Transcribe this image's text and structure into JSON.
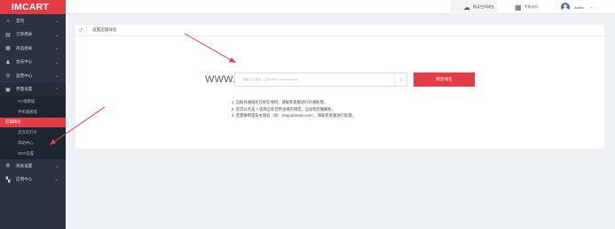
{
  "app": {
    "logo": "IMCART"
  },
  "sidebar": {
    "items": [
      {
        "label": "首页",
        "icon": "home-icon"
      },
      {
        "label": "订单相关",
        "icon": "order-icon"
      },
      {
        "label": "商品相关",
        "icon": "goods-icon"
      },
      {
        "label": "会员中心",
        "icon": "member-icon"
      },
      {
        "label": "运营中心",
        "icon": "operation-icon"
      },
      {
        "label": "界面设置",
        "icon": "layout-icon"
      },
      {
        "label": "系统设置",
        "icon": "settings-icon"
      },
      {
        "label": "应用中心",
        "icon": "apps-icon"
      }
    ],
    "sub_items": [
      "PC端模版",
      "手机端模版",
      "店铺域名",
      "首页幻灯片",
      "帮助中心",
      "SEO设置"
    ]
  },
  "header": {
    "tools": [
      {
        "label": "购买空间域名",
        "icon": "cloud-link-icon"
      },
      {
        "label": "手机访问",
        "icon": "qrcode-icon"
      }
    ],
    "user": {
      "name": "Admin",
      "icon": "avatar-icon"
    }
  },
  "main": {
    "title": "设置店铺域名",
    "prefix": "WWW.",
    "domain_input": {
      "value": "",
      "placeholder": "请输入主域名，如imcart.com,imcart.net"
    },
    "bind_button": "绑定域名",
    "tips": [
      "1. 自助开通域名已经在线时，请联系客服进行开通处理。",
      "2. 您可以点击 > 选择自有可用主域名绑定，自动帮您做解析。",
      "3. 若需要绑定非主域名（如：shop.domain.com），请联系客服进行处理。"
    ]
  },
  "colors": {
    "brand": "#e23d45",
    "sidebar_bg": "#2b3241",
    "annotation": "#e23d45"
  }
}
